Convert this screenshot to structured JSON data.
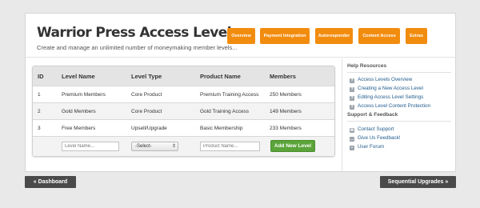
{
  "header": {
    "title": "Warrior Press Access Levels",
    "subtitle": "Create and manage an unlimited number of moneymaking member levels..."
  },
  "nav": {
    "overview": "Overview",
    "payment_integration": "Payment Integration",
    "autoresponder": "Autoresponder",
    "content_access": "Content Access",
    "extras": "Extras"
  },
  "table": {
    "headers": [
      "ID",
      "Level Name",
      "Level Type",
      "Product Name",
      "Members"
    ],
    "rows": [
      {
        "id": "1",
        "level_name": "Premium Members",
        "level_type": "Core Product",
        "product_name": "Premium Training Access",
        "members": "250 Members"
      },
      {
        "id": "2",
        "level_name": "Gold Members",
        "level_type": "Core Product",
        "product_name": "Gold Training Access",
        "members": "149 Members"
      },
      {
        "id": "3",
        "level_name": "Free Members",
        "level_type": "Upsell/Upgrade",
        "product_name": "Basic Membership",
        "members": "233 Members"
      }
    ],
    "new_row": {
      "level_name_placeholder": "Level Name...",
      "level_type_selected": "-Select-",
      "product_name_placeholder": "Product Name...",
      "add_button": "Add New Level"
    }
  },
  "sidebar": {
    "help_title": "Help Resources",
    "help_items": [
      {
        "label": "Access Levels Overview",
        "icon": "help-icon"
      },
      {
        "label": "Creating a New Access Level",
        "icon": "help-icon"
      },
      {
        "label": "Editing Access Level Settings",
        "icon": "help-icon"
      },
      {
        "label": "Access Level Content Protection",
        "icon": "help-icon"
      }
    ],
    "support_title": "Support & Feedback",
    "support_items": [
      {
        "label": "Contact Support",
        "icon": "mail-icon"
      },
      {
        "label": "Give Us Feedback!",
        "icon": "chat-icon"
      },
      {
        "label": "User Forum",
        "icon": "forum-icon"
      }
    ]
  },
  "footer": {
    "back": "« Dashboard",
    "next": "Sequential Upgrades »"
  },
  "colors": {
    "nav_orange": "#f28c0f",
    "add_green": "#5aa43a",
    "link_blue": "#1f5a8c",
    "footer_dark": "#4a4a4a"
  }
}
